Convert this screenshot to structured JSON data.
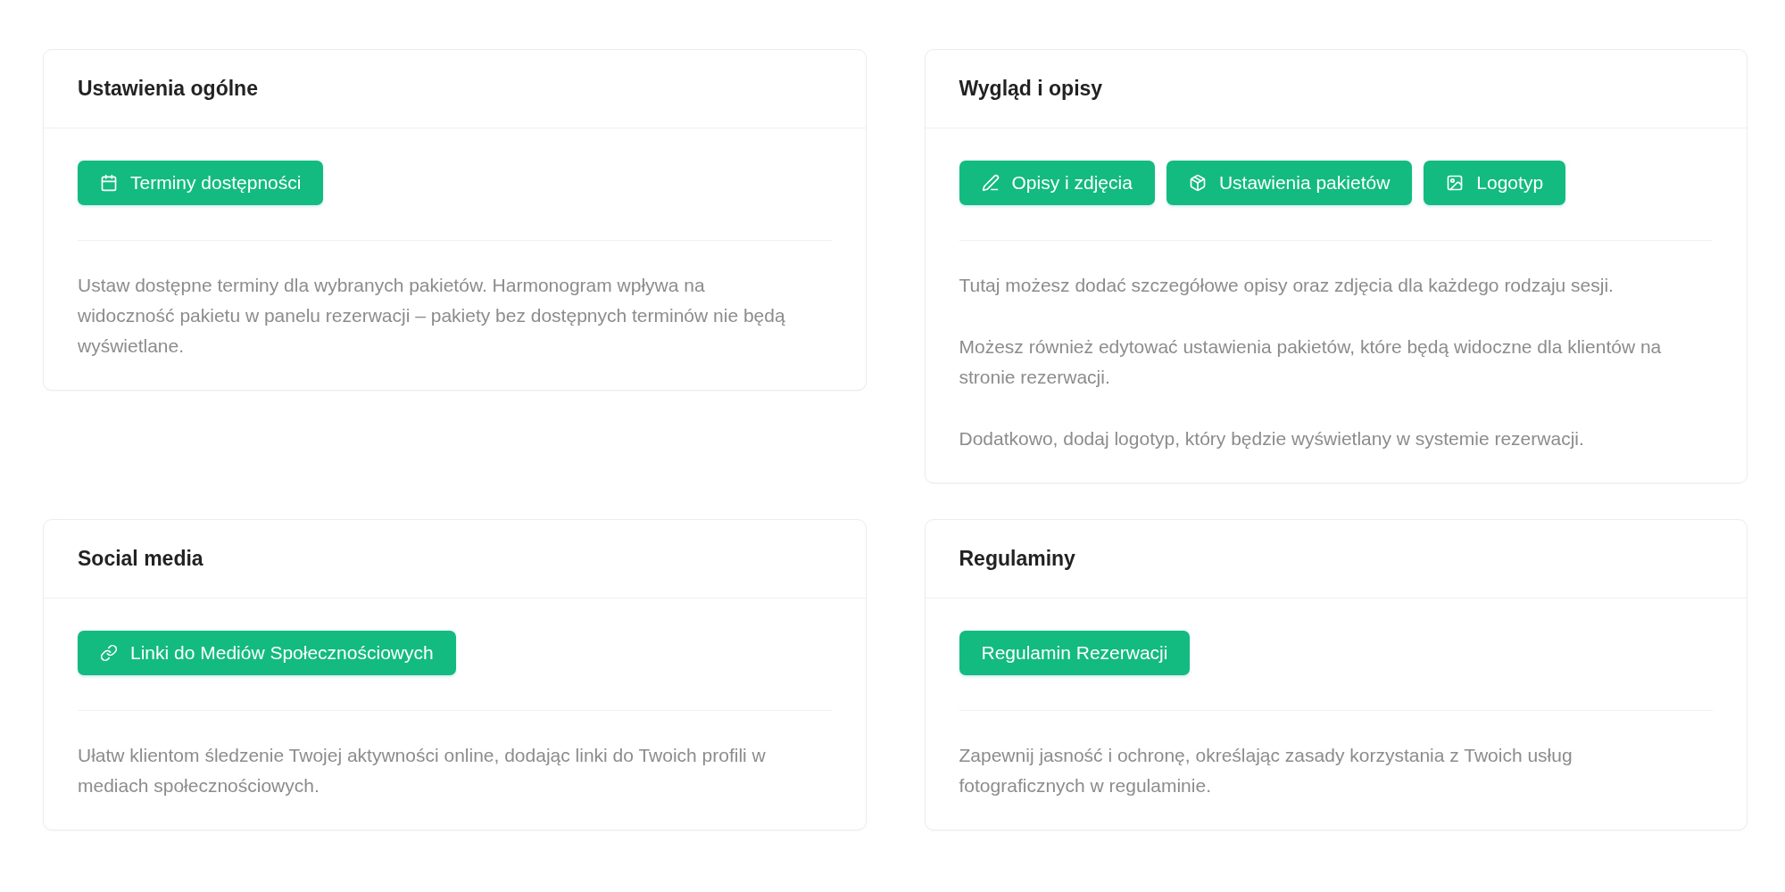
{
  "cards": [
    {
      "title": "Ustawienia ogólne",
      "buttons": [
        {
          "label": "Terminy dostępności",
          "kind": "calendar"
        }
      ],
      "paragraphs": [
        "Ustaw dostępne terminy dla wybranych pakietów. Harmonogram wpływa na widoczność pakietu w panelu rezerwacji – pakiety bez dostępnych terminów nie będą wyświetlane."
      ]
    },
    {
      "title": "Wygląd i opisy",
      "buttons": [
        {
          "label": "Opisy i zdjęcia",
          "kind": "pencil"
        },
        {
          "label": "Ustawienia pakietów",
          "kind": "package"
        },
        {
          "label": "Logotyp",
          "kind": "image"
        }
      ],
      "paragraphs": [
        "Tutaj możesz dodać szczegółowe opisy oraz zdjęcia dla każdego rodzaju sesji.",
        "Możesz również edytować ustawienia pakietów, które będą widoczne dla klientów na stronie rezerwacji.",
        "Dodatkowo, dodaj logotyp, który będzie wyświetlany w systemie rezerwacji."
      ]
    },
    {
      "title": "Social media",
      "buttons": [
        {
          "label": "Linki do Mediów Społecznościowych",
          "kind": "link"
        }
      ],
      "paragraphs": [
        "Ułatw klientom śledzenie Twojej aktywności online, dodając linki do Twoich profili w mediach społecznościowych."
      ]
    },
    {
      "title": "Regulaminy",
      "buttons": [
        {
          "label": "Regulamin Rezerwacji",
          "kind": "plain"
        }
      ],
      "paragraphs": [
        "Zapewnij jasność i ochronę, określając zasady korzystania z Twoich usług fotograficznych w regulaminie."
      ]
    }
  ]
}
